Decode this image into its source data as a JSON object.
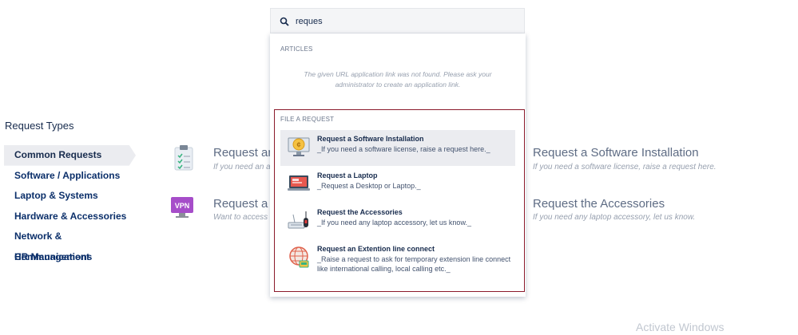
{
  "request_types": {
    "title": "Request Types",
    "items": [
      {
        "label": "Common Requests"
      },
      {
        "label": "Software / Applications"
      },
      {
        "label": "Laptop & Systems"
      },
      {
        "label": "Hardware & Accessories"
      },
      {
        "label": "Network & Communications"
      },
      {
        "label": "HR Management"
      }
    ]
  },
  "cards": [
    {
      "title": "Request an At",
      "desc": "If you need an atte",
      "icon": "clipboard-icon"
    },
    {
      "title": "Request a VPN",
      "desc": "Want to access wo",
      "icon": "vpn-icon"
    },
    {
      "title": "Request a Software Installation",
      "desc": "If you need a software license, raise a request here."
    },
    {
      "title": "Request the Accessories",
      "desc": "If you need any laptop accessory, let us know."
    }
  ],
  "search": {
    "value": "reques",
    "icon": "search-icon"
  },
  "dropdown": {
    "articles_label": "ARTICLES",
    "articles_msg_line1": "The given URL application link was not found. Please ask your",
    "articles_msg_line2": "administrator to create an application link.",
    "file_label": "FILE A REQUEST",
    "results": [
      {
        "title": "Request a Software Installation",
        "desc": "_If you need a software license, raise a request here._",
        "icon": "monitor-coin-icon"
      },
      {
        "title": "Request a Laptop",
        "desc": "_Request a Desktop or Laptop._",
        "icon": "laptop-icon"
      },
      {
        "title": "Request the Accessories",
        "desc": "_If you need any laptop accessory, let us know._",
        "icon": "keyboard-mouse-icon"
      },
      {
        "title": "Request an Extention line connect",
        "desc": "_Raise a request to ask for temporary extension line connect like international calling, local calling etc._",
        "icon": "globe-phone-icon"
      }
    ]
  },
  "watermark": "Activate Windows",
  "colors": {
    "highlight_border": "#8b1a2b",
    "active_bg": "#ebecf0",
    "link_blue": "#0b2f6a"
  }
}
